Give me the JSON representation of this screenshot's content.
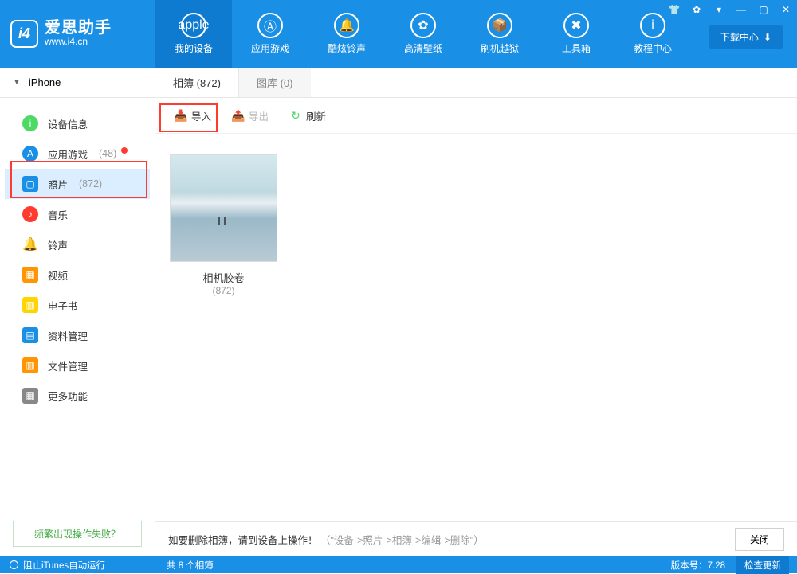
{
  "logo": {
    "badge": "i4",
    "title": "爱思助手",
    "url": "www.i4.cn"
  },
  "nav": [
    {
      "label": "我的设备",
      "icon": "apple"
    },
    {
      "label": "应用游戏",
      "icon": "A"
    },
    {
      "label": "酷炫铃声",
      "icon": "bell"
    },
    {
      "label": "高清壁纸",
      "icon": "flower"
    },
    {
      "label": "刷机越狱",
      "icon": "box"
    },
    {
      "label": "工具箱",
      "icon": "wrench"
    },
    {
      "label": "教程中心",
      "icon": "i"
    }
  ],
  "download_center": "下载中心",
  "device": {
    "name": "iPhone"
  },
  "sidebar": [
    {
      "label": "设备信息",
      "iconColor": "#4cd964",
      "iconGlyph": "i"
    },
    {
      "label": "应用游戏",
      "count": "(48)",
      "iconColor": "#1a8fe6",
      "iconGlyph": "A",
      "dot": true
    },
    {
      "label": "照片",
      "count": "(872)",
      "iconColor": "#1a8fe6",
      "iconGlyph": "▢",
      "active": true,
      "square": true
    },
    {
      "label": "音乐",
      "iconColor": "#ff3b30",
      "iconGlyph": "♪"
    },
    {
      "label": "铃声",
      "iconColor": "#1a8fe6",
      "iconGlyph": "🔔",
      "noCircle": true
    },
    {
      "label": "视频",
      "iconColor": "#ff9500",
      "iconGlyph": "▦",
      "square": true
    },
    {
      "label": "电子书",
      "iconColor": "#ffd400",
      "iconGlyph": "▥",
      "square": true
    },
    {
      "label": "资料管理",
      "iconColor": "#1a8fe6",
      "iconGlyph": "▤",
      "square": true
    },
    {
      "label": "文件管理",
      "iconColor": "#ff9500",
      "iconGlyph": "▥",
      "square": true
    },
    {
      "label": "更多功能",
      "iconColor": "#888",
      "iconGlyph": "▦",
      "square": true
    }
  ],
  "help_link": "频繁出现操作失败？",
  "tabs": [
    {
      "label": "相簿",
      "count": "(872)",
      "active": true
    },
    {
      "label": "图库",
      "count": "(0)"
    }
  ],
  "toolbar": {
    "import": "导入",
    "export": "导出",
    "refresh": "刷新"
  },
  "albums": [
    {
      "name": "相机胶卷",
      "count": "(872)"
    }
  ],
  "hint": {
    "text": "如要删除相簿，请到设备上操作！",
    "path": "（\"设备->照片->相簿->编辑->删除\"）",
    "close": "关闭"
  },
  "footer": {
    "itunes": "阻止iTunes自动运行",
    "summary": "共 8 个相簿",
    "version_label": "版本号：",
    "version": "7.28",
    "check_update": "检查更新"
  }
}
